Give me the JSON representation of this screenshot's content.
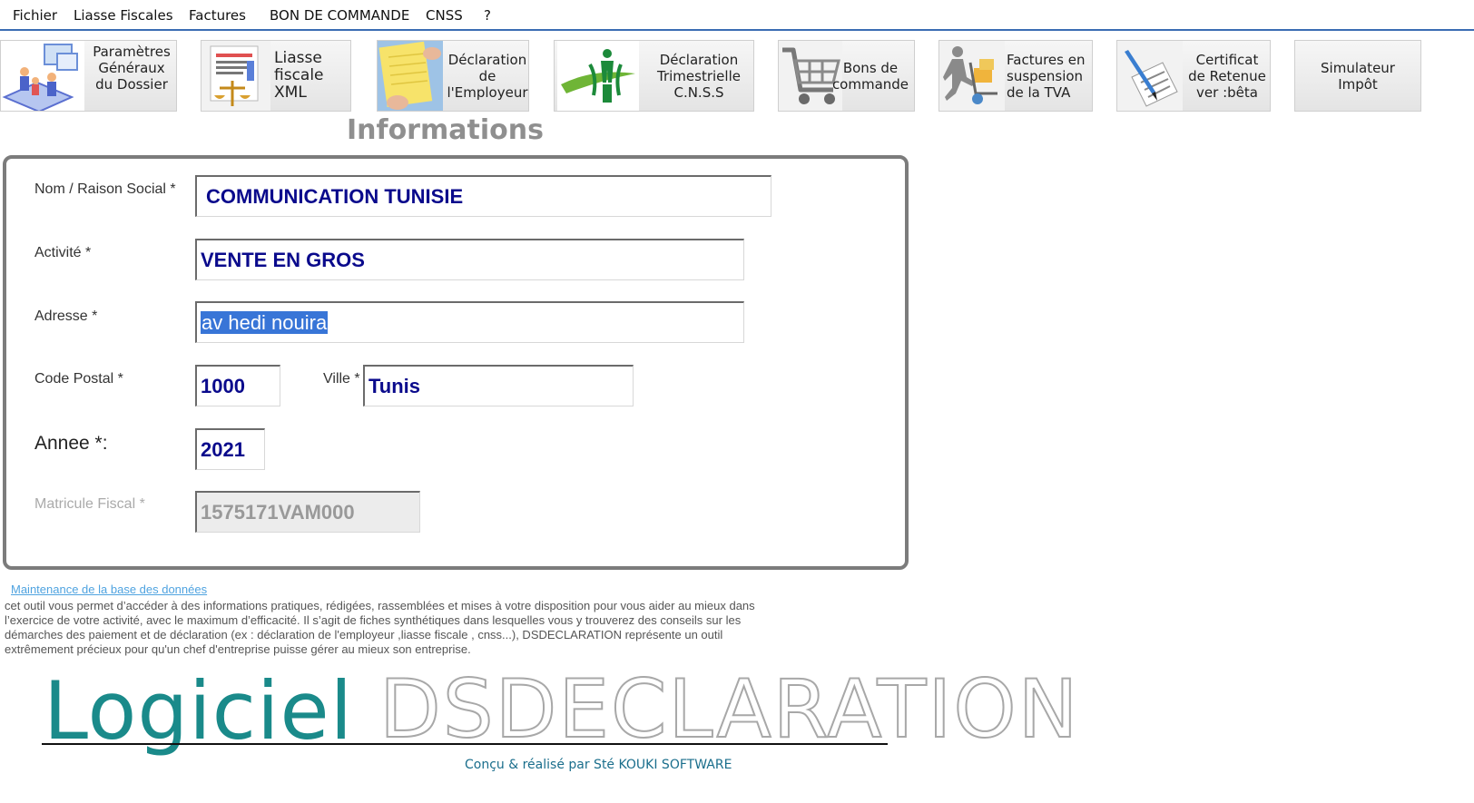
{
  "menu": [
    "Fichier",
    "Liasse Fiscales",
    "Factures",
    "BON DE COMMANDE",
    "CNSS",
    "?"
  ],
  "toolbar": [
    {
      "label": "Paramètres\nGénéraux\ndu Dossier",
      "icon": "team-dashboard-icon"
    },
    {
      "label": "Liasse\nfiscale\nXML",
      "icon": "balance-document-icon"
    },
    {
      "label": "Déclaration\nde\nl'Employeur",
      "icon": "notepad-hand-icon"
    },
    {
      "label": "Déclaration\nTrimestrielle\nC.N.S.S",
      "icon": "cnss-logo-icon"
    },
    {
      "label": "Bons de\ncommande",
      "icon": "shopping-cart-icon"
    },
    {
      "label": "Factures en\nsuspension\nde la TVA",
      "icon": "delivery-trolley-icon"
    },
    {
      "label": "Certificat\nde Retenue\nver :bêta",
      "icon": "pen-certificate-icon"
    },
    {
      "label": "Simulateur\nImpôt",
      "icon": ""
    }
  ],
  "section_title": "Informations",
  "form": {
    "nom_label": "Nom  / Raison Social *",
    "nom_value": "COMMUNICATION TUNISIE",
    "activite_label": "Activité  *",
    "activite_value": "VENTE  EN GROS",
    "adresse_label": "Adresse *",
    "adresse_value": "av hedi nouira",
    "cp_label": "Code Postal *",
    "cp_value": "1000",
    "ville_label": "Ville *",
    "ville_value": "Tunis",
    "annee_label": "Annee *:",
    "annee_value": "2021",
    "matricule_label": "Matricule Fiscal *",
    "matricule_value": "1575171VAM000"
  },
  "maintenance_link": "Maintenance de la base des données ",
  "description": " cet outil vous permet d’accéder à des informations pratiques, rédigées, rassemblées et mises à votre disposition pour vous aider au mieux dans l’exercice de votre activité, avec le maximum d’efficacité. Il s’agit de fiches synthétiques dans lesquelles vous y trouverez des conseils sur les démarches des paiement et de déclaration (ex :  déclaration de l'employeur ,liasse fiscale , cnss...), DSDECLARATION représente un outil extrêmement précieux pour qu'un chef d'entreprise puisse gérer au mieux son entreprise.",
  "logo": {
    "word1": "Logiciel",
    "word2": "DSDECLARATION"
  },
  "credit": "Conçu & réalisé par Sté KOUKI SOFTWARE",
  "colors": {
    "accent": "#3b6db3",
    "field_text": "#0a0a8c",
    "logo_teal": "#1a8a8a",
    "selection": "#3875d7"
  }
}
